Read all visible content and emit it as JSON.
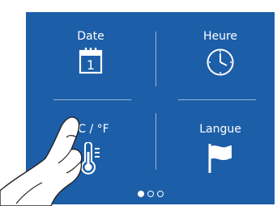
{
  "screen": {
    "background": "#1d5ea8",
    "tiles": [
      {
        "label": "Date",
        "icon": "calendar-icon",
        "calendar_day": "1"
      },
      {
        "label": "Heure",
        "icon": "clock-icon"
      },
      {
        "label": "°C / °F",
        "icon": "thermometer-icon"
      },
      {
        "label": "Langue",
        "icon": "flag-icon"
      }
    ],
    "pager": {
      "pages": 3,
      "current": 1
    }
  },
  "overlay": {
    "icon": "pointing-hand-icon"
  }
}
